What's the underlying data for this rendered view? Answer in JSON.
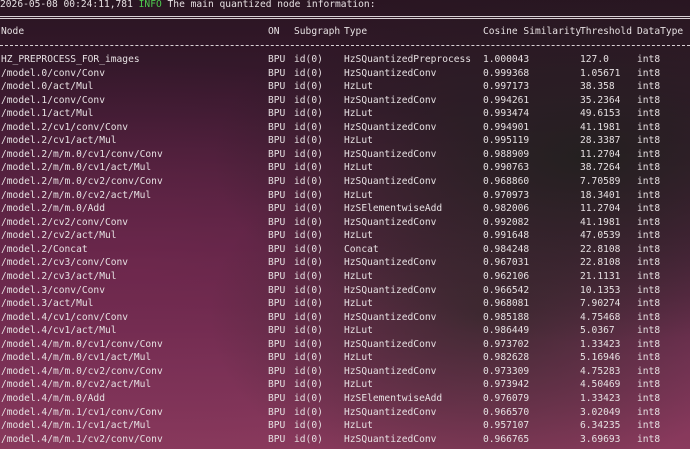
{
  "log": {
    "timestamp": "2026-05-08 00:24:11,781",
    "level": "INFO",
    "message": "The main quantized node information:"
  },
  "table": {
    "headers": [
      "Node",
      "ON",
      "Subgraph",
      "Type",
      "Cosine Similarity",
      "Threshold",
      "DataType"
    ],
    "rows": [
      [
        "HZ_PREPROCESS_FOR_images",
        "BPU",
        "id(0)",
        "HzSQuantizedPreprocess",
        "1.000043",
        "127.0",
        "int8"
      ],
      [
        "/model.0/conv/Conv",
        "BPU",
        "id(0)",
        "HzSQuantizedConv",
        "0.999368",
        "1.05671",
        "int8"
      ],
      [
        "/model.0/act/Mul",
        "BPU",
        "id(0)",
        "HzLut",
        "0.997173",
        "38.358",
        "int8"
      ],
      [
        "/model.1/conv/Conv",
        "BPU",
        "id(0)",
        "HzSQuantizedConv",
        "0.994261",
        "35.2364",
        "int8"
      ],
      [
        "/model.1/act/Mul",
        "BPU",
        "id(0)",
        "HzLut",
        "0.993474",
        "49.6153",
        "int8"
      ],
      [
        "/model.2/cv1/conv/Conv",
        "BPU",
        "id(0)",
        "HzSQuantizedConv",
        "0.994901",
        "41.1981",
        "int8"
      ],
      [
        "/model.2/cv1/act/Mul",
        "BPU",
        "id(0)",
        "HzLut",
        "0.995119",
        "28.3387",
        "int8"
      ],
      [
        "/model.2/m/m.0/cv1/conv/Conv",
        "BPU",
        "id(0)",
        "HzSQuantizedConv",
        "0.988909",
        "11.2704",
        "int8"
      ],
      [
        "/model.2/m/m.0/cv1/act/Mul",
        "BPU",
        "id(0)",
        "HzLut",
        "0.990763",
        "38.7264",
        "int8"
      ],
      [
        "/model.2/m/m.0/cv2/conv/Conv",
        "BPU",
        "id(0)",
        "HzSQuantizedConv",
        "0.968860",
        "7.70589",
        "int8"
      ],
      [
        "/model.2/m/m.0/cv2/act/Mul",
        "BPU",
        "id(0)",
        "HzLut",
        "0.970973",
        "18.3401",
        "int8"
      ],
      [
        "/model.2/m/m.0/Add",
        "BPU",
        "id(0)",
        "HzSElementwiseAdd",
        "0.982006",
        "11.2704",
        "int8"
      ],
      [
        "/model.2/cv2/conv/Conv",
        "BPU",
        "id(0)",
        "HzSQuantizedConv",
        "0.992082",
        "41.1981",
        "int8"
      ],
      [
        "/model.2/cv2/act/Mul",
        "BPU",
        "id(0)",
        "HzLut",
        "0.991648",
        "47.0539",
        "int8"
      ],
      [
        "/model.2/Concat",
        "BPU",
        "id(0)",
        "Concat",
        "0.984248",
        "22.8108",
        "int8"
      ],
      [
        "/model.2/cv3/conv/Conv",
        "BPU",
        "id(0)",
        "HzSQuantizedConv",
        "0.967031",
        "22.8108",
        "int8"
      ],
      [
        "/model.2/cv3/act/Mul",
        "BPU",
        "id(0)",
        "HzLut",
        "0.962106",
        "21.1131",
        "int8"
      ],
      [
        "/model.3/conv/Conv",
        "BPU",
        "id(0)",
        "HzSQuantizedConv",
        "0.966542",
        "10.1353",
        "int8"
      ],
      [
        "/model.3/act/Mul",
        "BPU",
        "id(0)",
        "HzLut",
        "0.968081",
        "7.90274",
        "int8"
      ],
      [
        "/model.4/cv1/conv/Conv",
        "BPU",
        "id(0)",
        "HzSQuantizedConv",
        "0.985188",
        "4.75468",
        "int8"
      ],
      [
        "/model.4/cv1/act/Mul",
        "BPU",
        "id(0)",
        "HzLut",
        "0.986449",
        "5.0367",
        "int8"
      ],
      [
        "/model.4/m/m.0/cv1/conv/Conv",
        "BPU",
        "id(0)",
        "HzSQuantizedConv",
        "0.973702",
        "1.33423",
        "int8"
      ],
      [
        "/model.4/m/m.0/cv1/act/Mul",
        "BPU",
        "id(0)",
        "HzLut",
        "0.982628",
        "5.16946",
        "int8"
      ],
      [
        "/model.4/m/m.0/cv2/conv/Conv",
        "BPU",
        "id(0)",
        "HzSQuantizedConv",
        "0.973309",
        "4.75283",
        "int8"
      ],
      [
        "/model.4/m/m.0/cv2/act/Mul",
        "BPU",
        "id(0)",
        "HzLut",
        "0.973942",
        "4.50469",
        "int8"
      ],
      [
        "/model.4/m/m.0/Add",
        "BPU",
        "id(0)",
        "HzSElementwiseAdd",
        "0.976079",
        "1.33423",
        "int8"
      ],
      [
        "/model.4/m/m.1/cv1/conv/Conv",
        "BPU",
        "id(0)",
        "HzSQuantizedConv",
        "0.966570",
        "3.02049",
        "int8"
      ],
      [
        "/model.4/m/m.1/cv1/act/Mul",
        "BPU",
        "id(0)",
        "HzLut",
        "0.957107",
        "6.34235",
        "int8"
      ],
      [
        "/model.4/m/m.1/cv2/conv/Conv",
        "BPU",
        "id(0)",
        "HzSQuantizedConv",
        "0.966765",
        "3.69693",
        "int8"
      ]
    ]
  },
  "colors": {
    "info": "#4ec94e",
    "text": "#e6e0e2"
  }
}
